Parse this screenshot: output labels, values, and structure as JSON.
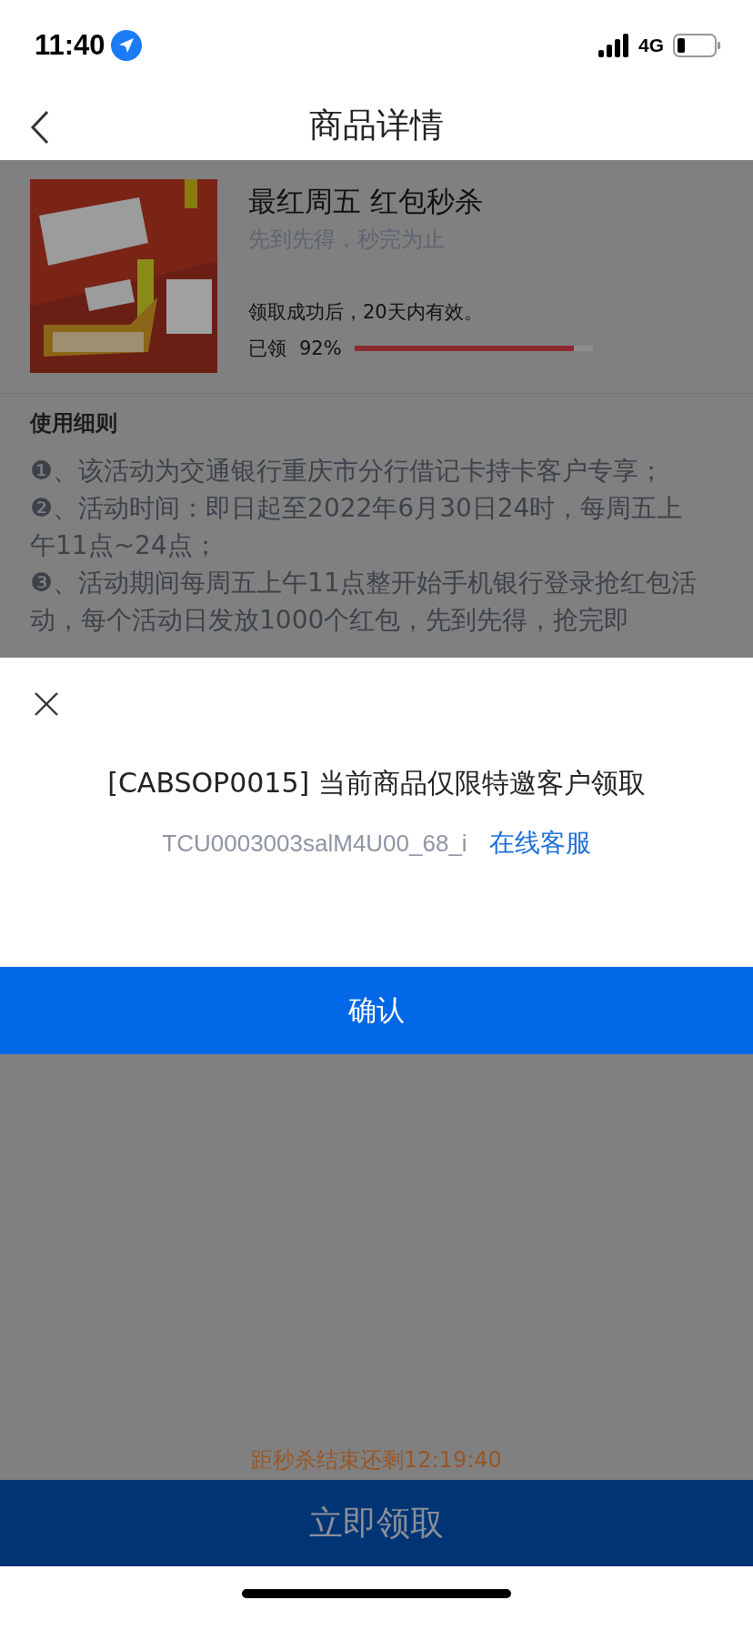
{
  "status_bar": {
    "time": "11:40",
    "network": "4G"
  },
  "nav_bar": {
    "title": "商品详情"
  },
  "product": {
    "title": "最红周五 红包秒杀",
    "subtitle": "先到先得，秒完为止",
    "validity": "领取成功后，20天内有效。",
    "claimed_label": "已领",
    "claimed_percent": "92%",
    "level": 0.92
  },
  "rules": {
    "title": "使用细则",
    "items": [
      "❶、该活动为交通银行重庆市分行借记卡持卡客户专享；",
      "❷、活动时间：即日起至2022年6月30日24时，每周五上午11点~24点；",
      "❸、活动期间每周五上午11点整开始手机银行登录抢红包活动，每个活动日发放1000个红包，先到先得，抢完即"
    ]
  },
  "dialog": {
    "message": "[CABSOP0015] 当前商品仅限特邀客户领取",
    "trace_code": "TCU0003003salM4U00_68_i",
    "link": "在线客服",
    "confirm": "确认"
  },
  "countdown": "距秒杀结束还剩12:19:40",
  "claim_button": "立即领取"
}
